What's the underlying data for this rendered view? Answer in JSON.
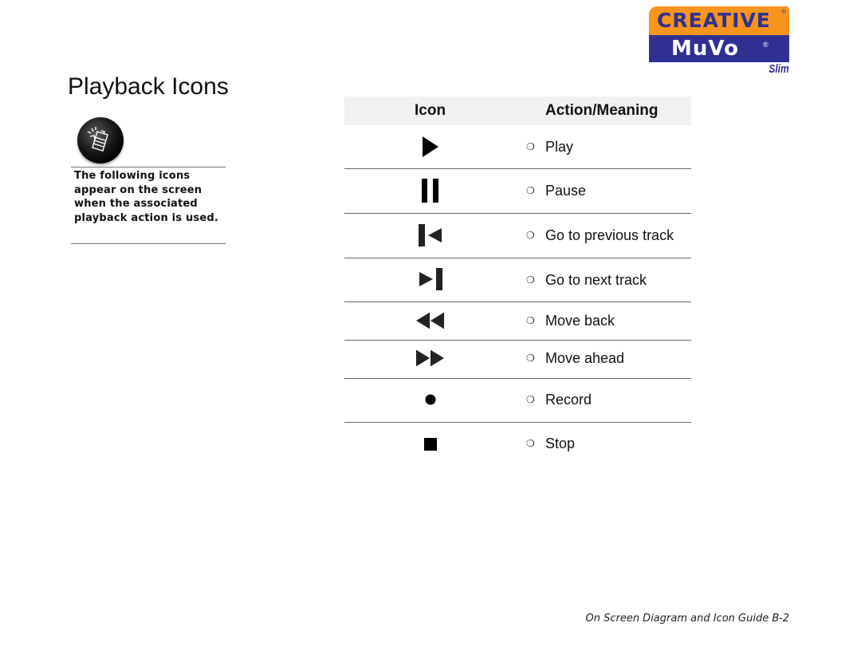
{
  "logo": {
    "brand": "CREATIVE",
    "product": "MuVo",
    "registered": "®",
    "variant": "Slim",
    "colors": {
      "orange": "#f7941d",
      "blue": "#2e3192"
    }
  },
  "page": {
    "title": "Playback Icons"
  },
  "note": {
    "icon": "note-icon",
    "text": "The following icons appear on the screen when the associated playback action is used."
  },
  "table": {
    "headers": {
      "icon": "Icon",
      "action": "Action/Meaning"
    },
    "bullet": "❍",
    "rows": [
      {
        "icon": "play-icon",
        "action": "Play"
      },
      {
        "icon": "pause-icon",
        "action": "Pause"
      },
      {
        "icon": "previous-track-icon",
        "action": "Go to previous track"
      },
      {
        "icon": "next-track-icon",
        "action": "Go to next track"
      },
      {
        "icon": "rewind-icon",
        "action": "Move back"
      },
      {
        "icon": "fast-forward-icon",
        "action": "Move ahead"
      },
      {
        "icon": "record-icon",
        "action": "Record"
      },
      {
        "icon": "stop-icon",
        "action": "Stop"
      }
    ]
  },
  "footer": {
    "text": "On Screen Diagram and Icon Guide B-2"
  }
}
